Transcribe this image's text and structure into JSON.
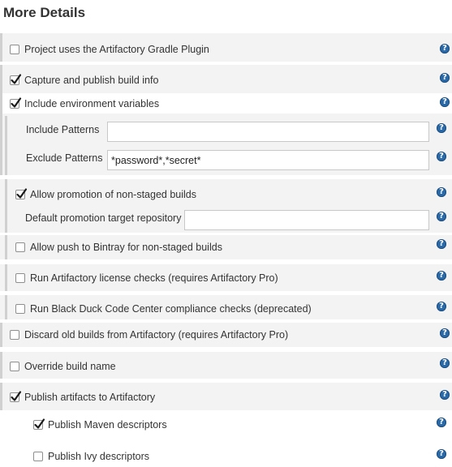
{
  "section": {
    "title": "More Details"
  },
  "items": {
    "gradle_plugin": {
      "label": "Project uses the Artifactory Gradle Plugin",
      "checked": false
    },
    "capture_build_info": {
      "label": "Capture and publish build info",
      "checked": true
    },
    "include_env_vars": {
      "label": "Include environment variables",
      "checked": true
    },
    "include_patterns": {
      "label": "Include Patterns",
      "value": ""
    },
    "exclude_patterns": {
      "label": "Exclude Patterns",
      "value": "*password*,*secret*"
    },
    "allow_promotion": {
      "label": "Allow promotion of non-staged builds",
      "checked": true
    },
    "default_promotion_repo": {
      "label": "Default promotion target repository",
      "value": ""
    },
    "allow_bintray": {
      "label": "Allow push to Bintray for non-staged builds",
      "checked": false
    },
    "license_checks": {
      "label": "Run Artifactory license checks (requires Artifactory Pro)",
      "checked": false
    },
    "black_duck": {
      "label": "Run Black Duck Code Center compliance checks (deprecated)",
      "checked": false
    },
    "discard_old_builds": {
      "label": "Discard old builds from Artifactory (requires Artifactory Pro)",
      "checked": false
    },
    "override_build_name": {
      "label": "Override build name",
      "checked": false
    },
    "publish_artifacts": {
      "label": "Publish artifacts to Artifactory",
      "checked": true
    },
    "publish_maven": {
      "label": "Publish Maven descriptors",
      "checked": true
    },
    "publish_ivy": {
      "label": "Publish Ivy descriptors",
      "checked": false
    }
  },
  "help_icon_glyph": "?",
  "colors": {
    "band": "#f3f3f3",
    "bar": "#d0d0d0",
    "help": "#2a6aa8"
  }
}
